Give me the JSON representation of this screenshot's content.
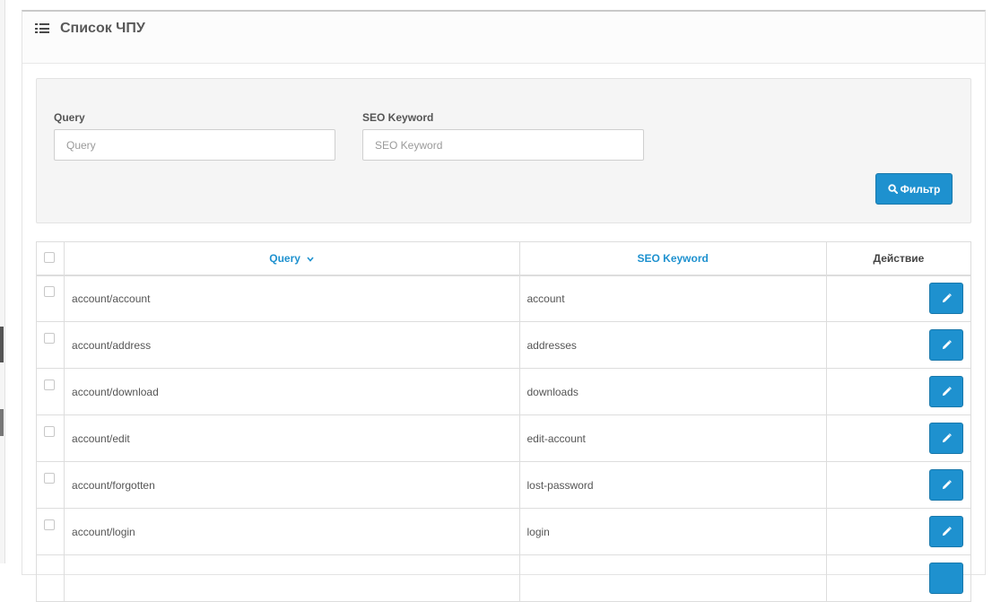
{
  "panel": {
    "title": "Список ЧПУ",
    "title_icon": "list-icon"
  },
  "filter": {
    "query_label": "Query",
    "query_placeholder": "Query",
    "query_value": "",
    "keyword_label": "SEO Keyword",
    "keyword_placeholder": "SEO Keyword",
    "keyword_value": "",
    "button_label": "Фильтр",
    "button_icon": "search-icon"
  },
  "table": {
    "columns": {
      "query": "Query",
      "keyword": "SEO Keyword",
      "action": "Действие"
    },
    "sort_icon": "chevron-down-icon",
    "edit_icon": "pencil-icon",
    "rows": [
      {
        "query": "account/account",
        "keyword": "account"
      },
      {
        "query": "account/address",
        "keyword": "addresses"
      },
      {
        "query": "account/download",
        "keyword": "downloads"
      },
      {
        "query": "account/edit",
        "keyword": "edit-account"
      },
      {
        "query": "account/forgotten",
        "keyword": "lost-password"
      },
      {
        "query": "account/login",
        "keyword": "login"
      }
    ]
  },
  "colors": {
    "primary": "#1e91cf",
    "well": "#f5f5f5"
  }
}
